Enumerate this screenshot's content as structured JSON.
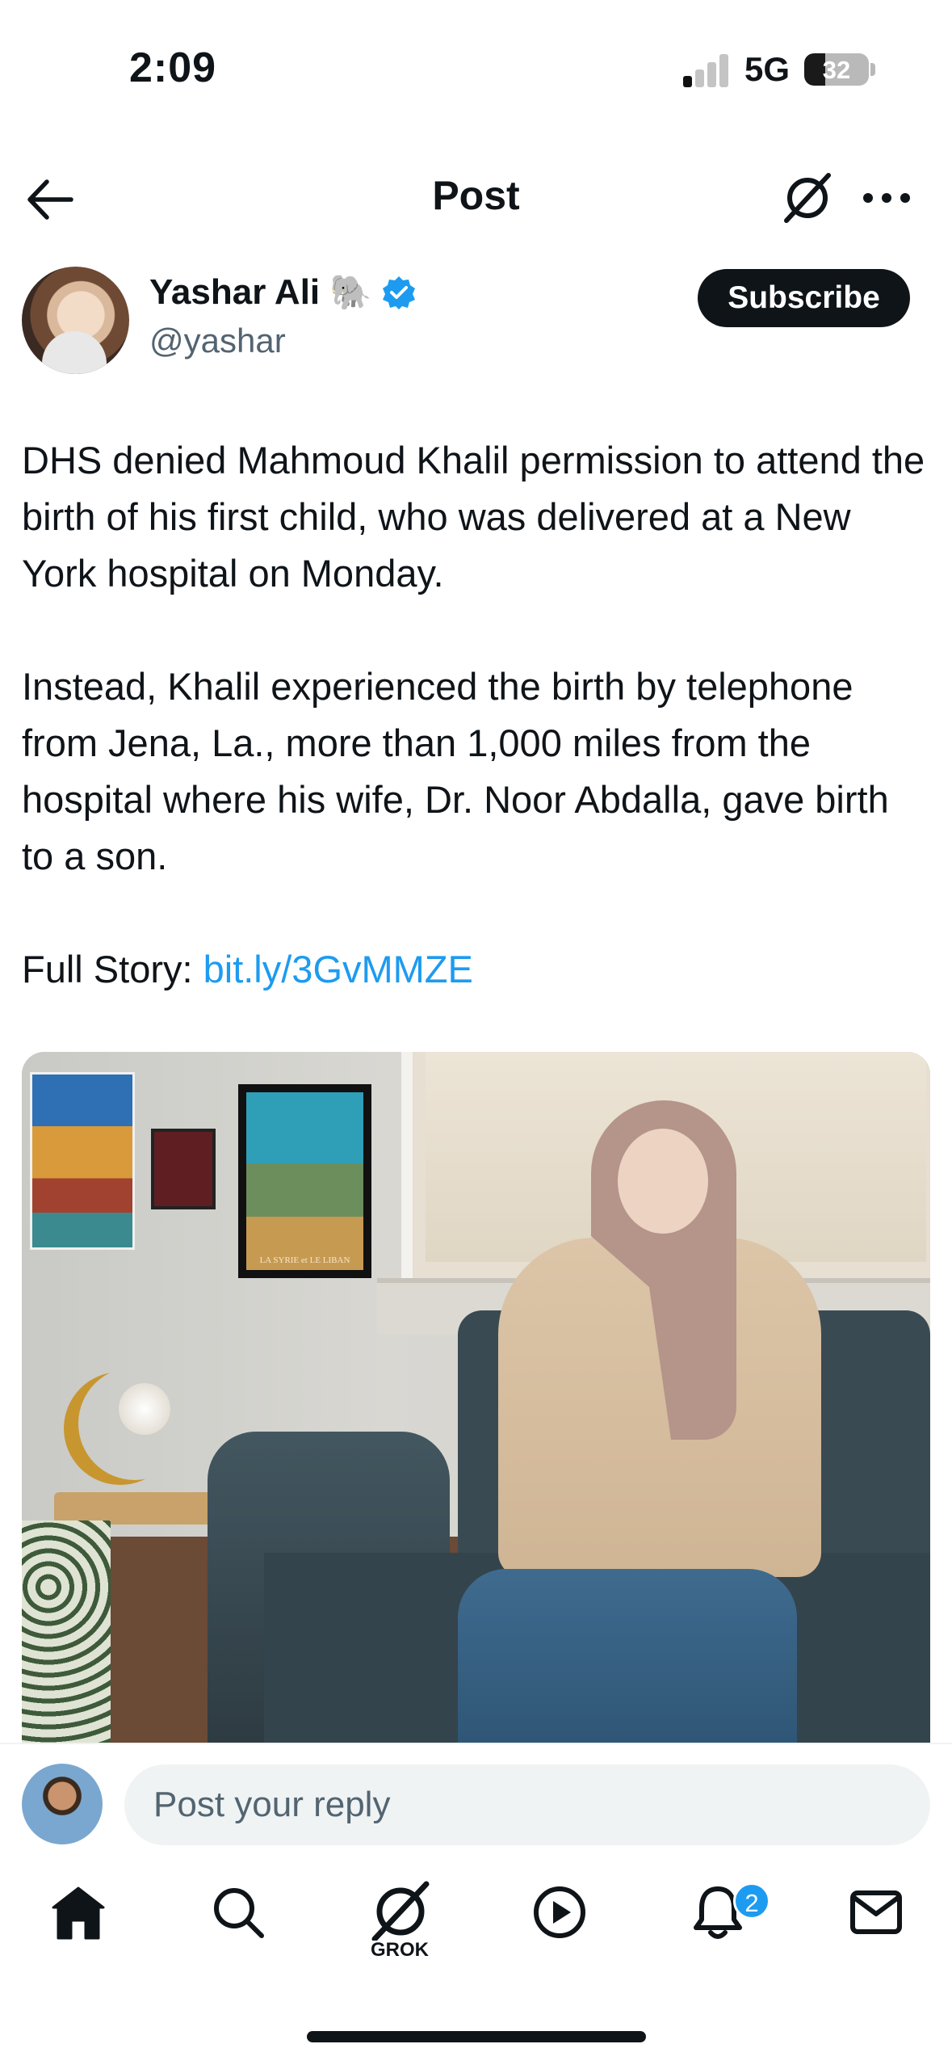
{
  "status_bar": {
    "time": "2:09",
    "network": "5G",
    "battery": "32",
    "battery_level": 0.32
  },
  "header": {
    "title": "Post"
  },
  "author": {
    "name": "Yashar Ali",
    "emoji": "🐘",
    "handle": "@yashar",
    "verified": true,
    "subscribe_label": "Subscribe"
  },
  "post": {
    "paragraph_1": "DHS denied Mahmoud Khalil permission to attend the birth of his first child, who was delivered at a New York hospital on Monday.",
    "paragraph_2": "Instead, Khalil experienced the birth by telephone from Jena, La., more than 1,000 miles from the hospital where his wife, Dr. Noor Abdalla, gave birth to a son.",
    "full_story_prefix": "Full Story: ",
    "link": "bit.ly/3GvMMZE",
    "photo_poster_text": "LA SYRIE et LE LIBAN"
  },
  "reply": {
    "placeholder": "Post your reply"
  },
  "tab_bar": {
    "items": [
      {
        "icon": "home-icon"
      },
      {
        "icon": "search-icon"
      },
      {
        "icon": "grok-icon",
        "label": "GROK"
      },
      {
        "icon": "play-icon"
      },
      {
        "icon": "bell-icon",
        "badge": "2"
      },
      {
        "icon": "mail-icon"
      }
    ]
  },
  "colors": {
    "accent": "#1d9bf0",
    "text": "#0f1419",
    "secondary": "#536471",
    "input_bg": "#eff3f4"
  }
}
